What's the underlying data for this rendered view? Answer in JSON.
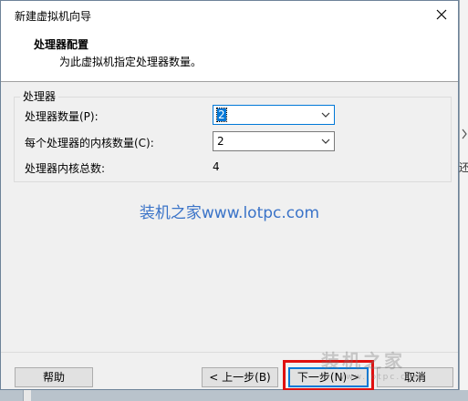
{
  "window": {
    "title": "新建虚拟机向导"
  },
  "header": {
    "title": "处理器配置",
    "subtitle": "为此虚拟机指定处理器数量。"
  },
  "processors": {
    "group_label": "处理器",
    "count_label": "处理器数量(P):",
    "count_value": "2",
    "cores_label": "每个处理器的内核数量(C):",
    "cores_value": "2",
    "total_label": "处理器内核总数:",
    "total_value": "4"
  },
  "watermark": "装机之家www.lotpc.com",
  "buttons": {
    "help": "帮助",
    "back": "< 上一步(B)",
    "next": "下一步(N) >",
    "cancel": "取消"
  },
  "background_window": {
    "partial_text": "还"
  },
  "logo": {
    "text": "装机之家",
    "sub": "www.lotpc.com"
  },
  "colors": {
    "accent": "#0078d7",
    "highlight": "#e01010",
    "watermark": "#3a73c8"
  }
}
